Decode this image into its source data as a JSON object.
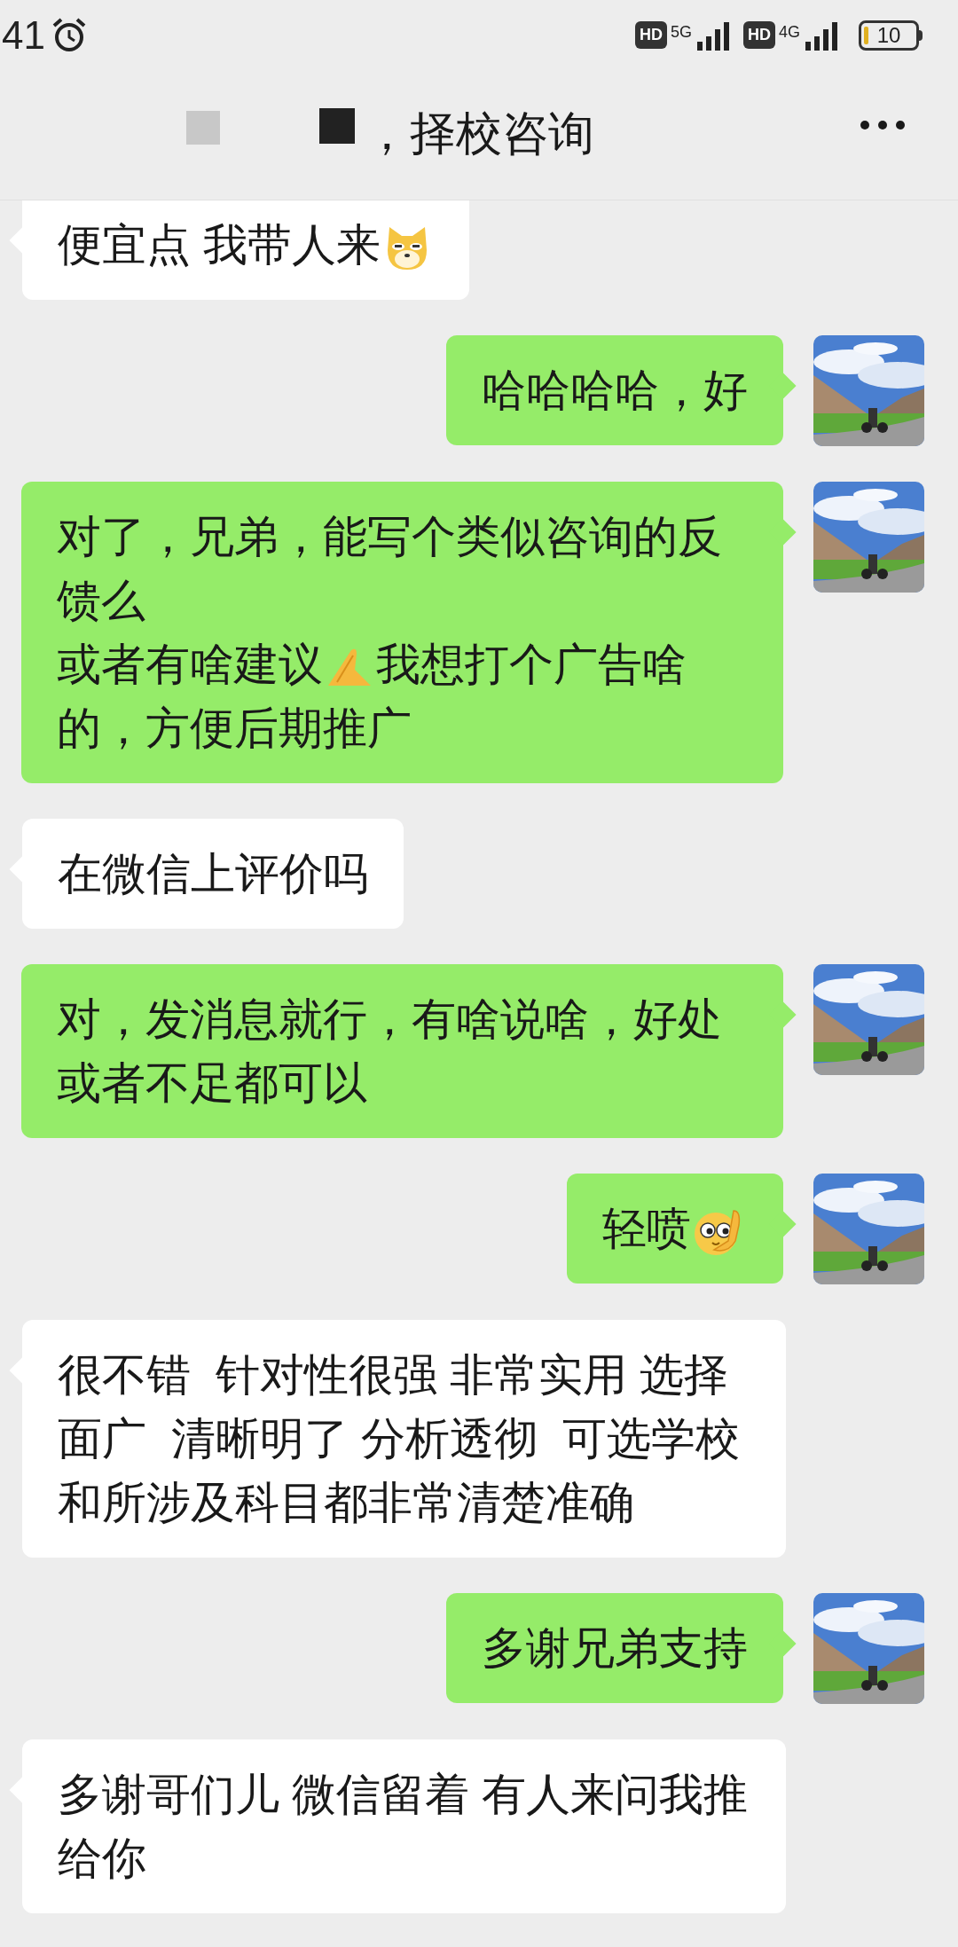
{
  "status_bar": {
    "time": "41",
    "network_1": {
      "hd": "HD",
      "type": "5G"
    },
    "network_2": {
      "hd": "HD",
      "type": "4G"
    },
    "battery": "10"
  },
  "header": {
    "title": "，择校咨询"
  },
  "messages": [
    {
      "kind": "received",
      "lines": [
        [
          {
            "kind": "text",
            "text": "便宜点 我带人来"
          },
          {
            "kind": "doge"
          }
        ]
      ]
    },
    {
      "kind": "sent",
      "lines": [
        [
          {
            "kind": "text",
            "text": "哈哈哈哈，好"
          }
        ]
      ]
    },
    {
      "kind": "sent",
      "lines": [
        [
          {
            "kind": "text",
            "text": "对了，兄弟，能写个类似咨询的反馈么"
          }
        ],
        [
          {
            "kind": "text",
            "text": "或者有啥建议"
          },
          {
            "kind": "palms"
          },
          {
            "kind": "text",
            "text": "我想打个广告啥的，方便后期推广"
          }
        ]
      ]
    },
    {
      "kind": "received",
      "lines": [
        [
          {
            "kind": "text",
            "text": "在微信上评价吗"
          }
        ]
      ]
    },
    {
      "kind": "sent",
      "lines": [
        [
          {
            "kind": "text",
            "text": "对，发消息就行，有啥说啥，好处或者不足都可以"
          }
        ]
      ]
    },
    {
      "kind": "sent",
      "lines": [
        [
          {
            "kind": "text",
            "text": "轻喷"
          },
          {
            "kind": "peek"
          }
        ]
      ]
    },
    {
      "kind": "received",
      "lines": [
        [
          {
            "kind": "text",
            "text": "很不错  针对性很强 非常实用 选择面广  清晰明了 分析透彻  可选学校和所涉及科目都非常清楚准确"
          }
        ]
      ]
    },
    {
      "kind": "sent",
      "lines": [
        [
          {
            "kind": "text",
            "text": "多谢兄弟支持"
          }
        ]
      ]
    },
    {
      "kind": "received",
      "lines": [
        [
          {
            "kind": "text",
            "text": "多谢哥们儿 微信留着 有人来问我推给你"
          }
        ]
      ]
    }
  ]
}
